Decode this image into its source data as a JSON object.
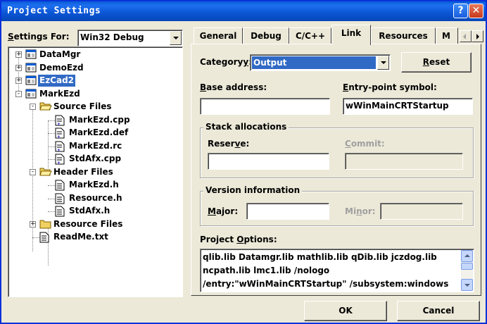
{
  "window": {
    "title": "Project Settings",
    "help_label": "?",
    "close_label": "✕"
  },
  "settings_for": {
    "label_pre": "",
    "label_hot": "S",
    "label_post": "ettings For:",
    "value": "Win32 Debug"
  },
  "tree": {
    "nodes": [
      {
        "label": "DataMgr",
        "icon": "project-icon",
        "expander": "+"
      },
      {
        "label": "DemoEzd",
        "icon": "project-icon",
        "expander": "+"
      },
      {
        "label": "EzCad2",
        "icon": "project-icon",
        "expander": "+",
        "selected": true
      },
      {
        "label": "MarkEzd",
        "icon": "project-icon",
        "expander": "-"
      },
      {
        "label": "Source Files",
        "icon": "folder-open-icon",
        "expander": "-"
      },
      {
        "label": "MarkEzd.cpp",
        "icon": "source-file-icon"
      },
      {
        "label": "MarkEzd.def",
        "icon": "source-file-icon"
      },
      {
        "label": "MarkEzd.rc",
        "icon": "source-file-icon"
      },
      {
        "label": "StdAfx.cpp",
        "icon": "source-file-icon"
      },
      {
        "label": "Header Files",
        "icon": "folder-open-icon",
        "expander": "-"
      },
      {
        "label": "MarkEzd.h",
        "icon": "text-file-icon"
      },
      {
        "label": "Resource.h",
        "icon": "text-file-icon"
      },
      {
        "label": "StdAfx.h",
        "icon": "text-file-icon"
      },
      {
        "label": "Resource Files",
        "icon": "folder-closed-icon",
        "expander": "+"
      },
      {
        "label": "ReadMe.txt",
        "icon": "text-file-icon"
      }
    ]
  },
  "tabs": [
    {
      "label": "General"
    },
    {
      "label": "Debug"
    },
    {
      "label": "C/C++"
    },
    {
      "label": "Link",
      "active": true
    },
    {
      "label": "Resources"
    },
    {
      "label": "M"
    }
  ],
  "link": {
    "category_label_pre": "Category",
    "category_label_hot": "y",
    "category_label_post": ":",
    "category_value": "Output",
    "reset_hot": "R",
    "reset_rest": "eset",
    "base_address_hot": "B",
    "base_address_rest": "ase address:",
    "base_address_value": "",
    "entry_hot": "E",
    "entry_rest": "ntry-point symbol:",
    "entry_value": "wWinMainCRTStartup",
    "stack_group": "Stack allocations",
    "reserve_pre": "Reser",
    "reserve_hot": "v",
    "reserve_post": "e:",
    "reserve_value": "",
    "commit_hot": "C",
    "commit_rest": "ommit:",
    "version_group": "Version information",
    "major_hot": "M",
    "major_rest": "ajor:",
    "major_value": "",
    "minor_pre": "Mi",
    "minor_hot": "n",
    "minor_post": "or:",
    "project_options_pre": "Project ",
    "project_options_hot": "O",
    "project_options_post": "ptions:",
    "project_options_text": "qlib.lib Datamgr.lib mathlib.lib qDib.lib jczdog.lib\nncpath.lib lmc1.lib /nologo\n/entry:\"wWinMainCRTStartup\" /subsystem:windows"
  },
  "buttons": {
    "ok": "OK",
    "cancel": "Cancel"
  },
  "colors": {
    "titlebar": "#0a5cd6",
    "selection": "#316ac5",
    "face": "#ece9d8"
  }
}
